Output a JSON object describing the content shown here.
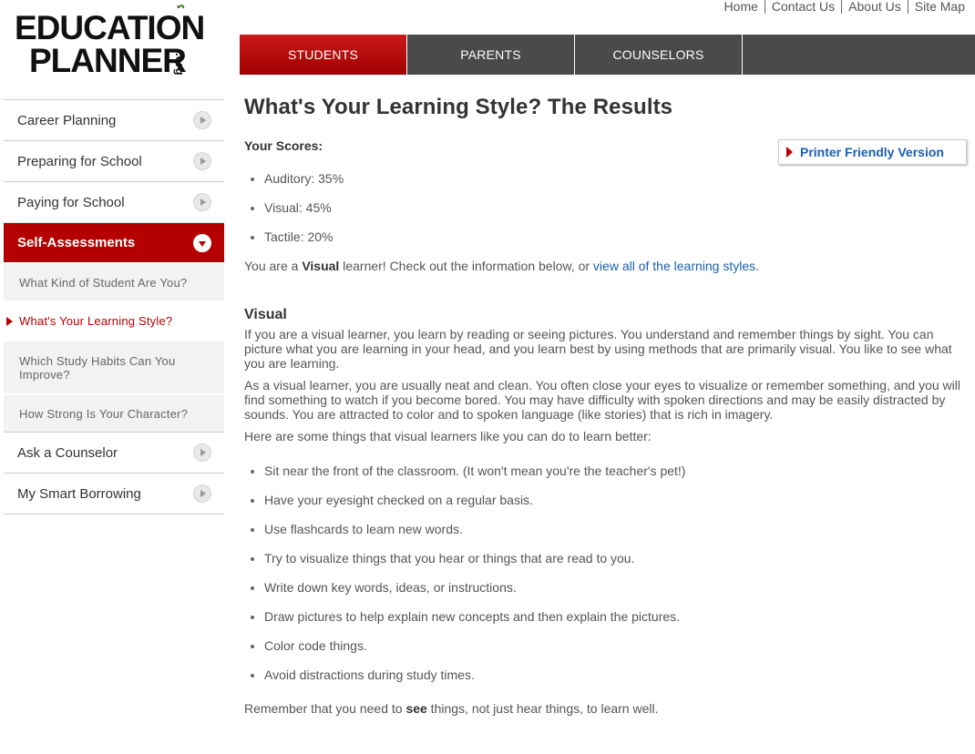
{
  "logo": {
    "line1": "EDUCATION",
    "line2": "PLANNER",
    "suffix": ".org"
  },
  "util_links": [
    "Home",
    "Contact Us",
    "About Us",
    "Site Map"
  ],
  "topnav": {
    "tabs": [
      "STUDENTS",
      "PARENTS",
      "COUNSELORS"
    ],
    "active": "STUDENTS"
  },
  "sidebar": {
    "items_top": [
      "Career Planning",
      "Preparing for School",
      "Paying for School"
    ],
    "active_section": "Self-Assessments",
    "sub_items": [
      "What Kind of Student Are You?",
      "What's Your Learning Style?",
      "Which Study Habits Can You Improve?",
      "How Strong Is Your Character?"
    ],
    "current_sub": "What's Your Learning Style?",
    "items_bottom": [
      "Ask a Counselor",
      "My Smart Borrowing"
    ]
  },
  "main": {
    "title": "What's Your Learning Style? The Results",
    "scores_label": "Your Scores:",
    "printer_label": "Printer Friendly Version",
    "scores": [
      "Auditory: 35%",
      "Visual: 45%",
      "Tactile: 20%"
    ],
    "summary": {
      "prefix": "You are a ",
      "style": "Visual",
      "middle": " learner! Check out the information below, or ",
      "link": "view all of the learning styles",
      "suffix": "."
    },
    "section_title": "Visual",
    "para1": "If you are a visual learner, you learn by reading or seeing pictures. You understand and remember things by sight. You can picture what you are learning in your head, and you learn best by using methods that are primarily visual. You like to see what you are learning.",
    "para2": "As a visual learner, you are usually neat and clean. You often close your eyes to visualize or remember something, and you will find something to watch if you become bored. You may have difficulty with spoken directions and may be easily distracted by sounds. You are attracted to color and to spoken language (like stories) that is rich in imagery.",
    "tips_intro": "Here are some things that visual learners like you can do to learn better:",
    "tips": [
      "Sit near the front of the classroom. (It won't mean you're the teacher's pet!)",
      "Have your eyesight checked on a regular basis.",
      "Use flashcards to learn new words.",
      "Try to visualize things that you hear or things that are read to you.",
      "Write down key words, ideas, or instructions.",
      "Draw pictures to help explain new concepts and then explain the pictures.",
      "Color code things.",
      "Avoid distractions during study times."
    ],
    "closing": {
      "prefix": "Remember that you need to ",
      "bold": "see",
      "suffix": " things, not just hear things, to learn well."
    }
  }
}
